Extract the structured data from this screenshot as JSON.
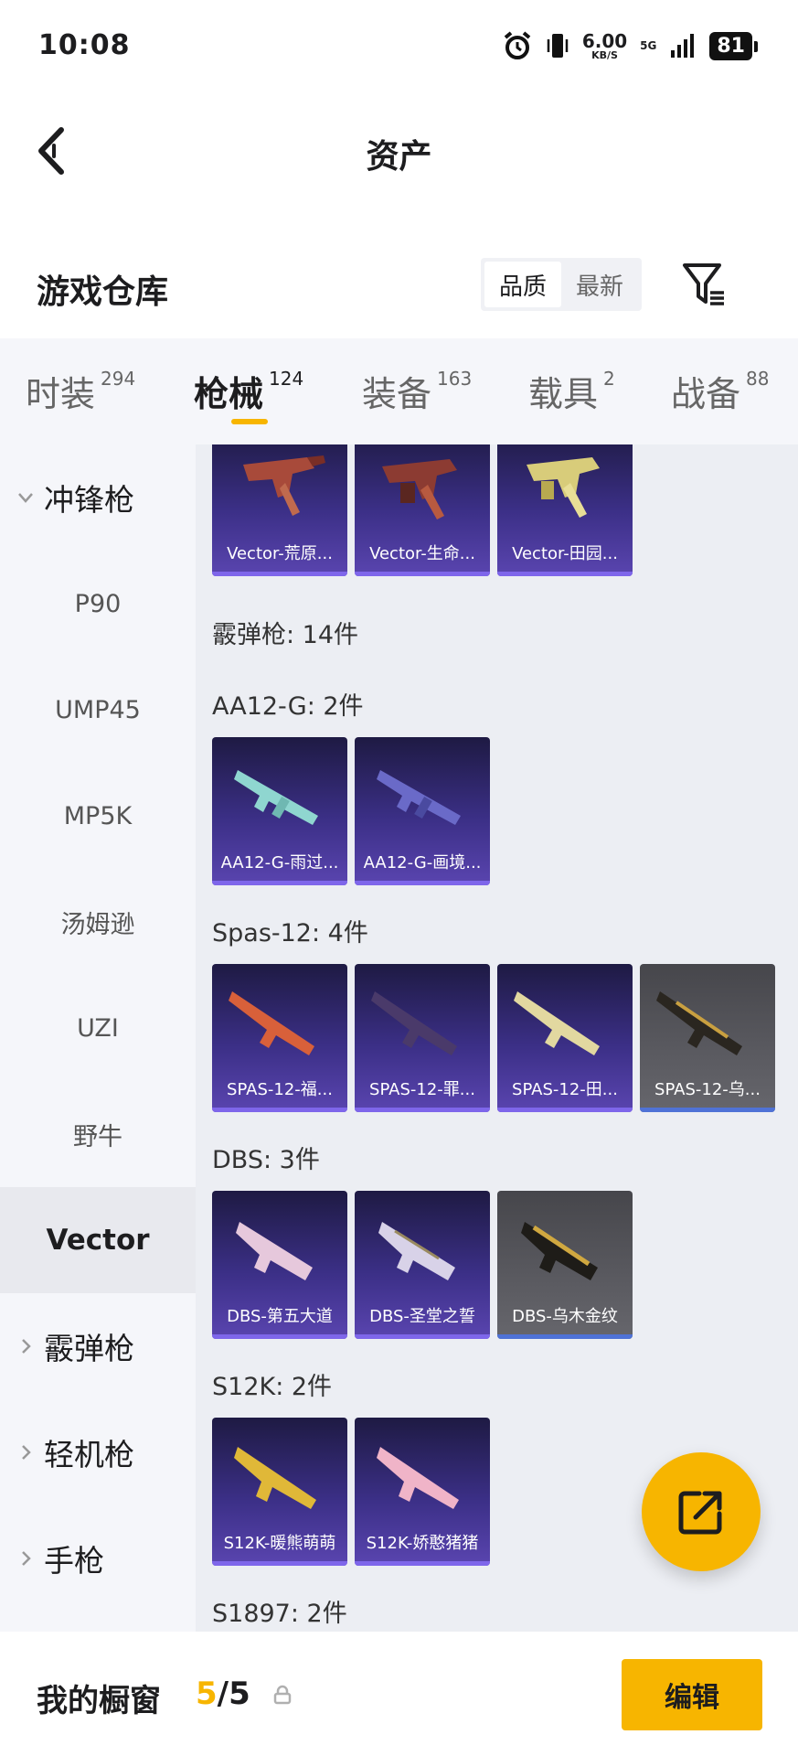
{
  "status_bar": {
    "time": "10:08",
    "net_speed": "6.00",
    "net_unit": "KB/S",
    "network": "5G",
    "battery": "81"
  },
  "nav": {
    "title": "资产",
    "back_icon": "back-chevron-icon"
  },
  "warehouse": {
    "title": "游戏仓库",
    "sort_options": [
      "品质",
      "最新"
    ],
    "sort_selected": "品质",
    "filter_icon": "filter-icon"
  },
  "tabs": [
    {
      "label": "时装",
      "count": "294"
    },
    {
      "label": "枪械",
      "count": "124",
      "active": true
    },
    {
      "label": "装备",
      "count": "163"
    },
    {
      "label": "载具",
      "count": "2"
    },
    {
      "label": "战备",
      "count": "88"
    }
  ],
  "sidebar": {
    "items": [
      {
        "label": "冲锋枪",
        "type": "group",
        "expanded": true
      },
      {
        "label": "P90"
      },
      {
        "label": "UMP45"
      },
      {
        "label": "MP5K"
      },
      {
        "label": "汤姆逊"
      },
      {
        "label": "UZI"
      },
      {
        "label": "野牛"
      },
      {
        "label": "Vector",
        "selected": true
      },
      {
        "label": "霰弹枪",
        "type": "group"
      },
      {
        "label": "轻机枪",
        "type": "group"
      },
      {
        "label": "手枪",
        "type": "group"
      }
    ]
  },
  "content": {
    "vector_cards": [
      "Vector-荒原...",
      "Vector-生命...",
      "Vector-田园..."
    ],
    "shotgun_header": "霰弹枪: 14件",
    "groups": [
      {
        "header": "AA12-G: 2件",
        "cards": [
          "AA12-G-雨过...",
          "AA12-G-画境..."
        ]
      },
      {
        "header": "Spas-12: 4件",
        "cards": [
          "SPAS-12-福...",
          "SPAS-12-罪...",
          "SPAS-12-田...",
          "SPAS-12-乌..."
        ]
      },
      {
        "header": "DBS: 3件",
        "cards": [
          "DBS-第五大道",
          "DBS-圣堂之誓",
          "DBS-乌木金纹"
        ]
      },
      {
        "header": "S12K: 2件",
        "cards": [
          "S12K-暖熊萌萌",
          "S12K-娇憨猪猪"
        ]
      },
      {
        "header": "S1897: 2件",
        "cards": []
      }
    ]
  },
  "fab_icon": "share-out-icon",
  "bottom": {
    "label": "我的橱窗",
    "current": "5",
    "separator": "/",
    "total": "5",
    "lock_icon": "lock-icon",
    "edit_label": "编辑"
  },
  "colors": {
    "accent": "#f7b500",
    "card_purple": "#3b2f86",
    "card_gray": "#5a5a60",
    "sidebar_bg": "#f5f6fa",
    "content_bg": "#eceef3"
  }
}
